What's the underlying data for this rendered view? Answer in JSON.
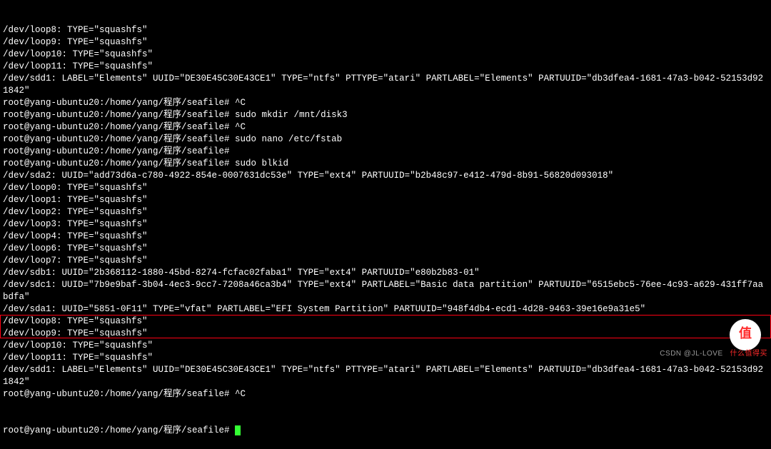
{
  "lines": [
    "/dev/loop8: TYPE=\"squashfs\"",
    "/dev/loop9: TYPE=\"squashfs\"",
    "/dev/loop10: TYPE=\"squashfs\"",
    "/dev/loop11: TYPE=\"squashfs\"",
    "/dev/sdd1: LABEL=\"Elements\" UUID=\"DE30E45C30E43CE1\" TYPE=\"ntfs\" PTTYPE=\"atari\" PARTLABEL=\"Elements\" PARTUUID=\"db3dfea4-1681-47a3-b042-52153d921842\"",
    "root@yang-ubuntu20:/home/yang/程序/seafile# ^C",
    "root@yang-ubuntu20:/home/yang/程序/seafile# sudo mkdir /mnt/disk3",
    "root@yang-ubuntu20:/home/yang/程序/seafile# ^C",
    "root@yang-ubuntu20:/home/yang/程序/seafile# sudo nano /etc/fstab",
    "root@yang-ubuntu20:/home/yang/程序/seafile#",
    "root@yang-ubuntu20:/home/yang/程序/seafile# sudo blkid",
    "/dev/sda2: UUID=\"add73d6a-c780-4922-854e-0007631dc53e\" TYPE=\"ext4\" PARTUUID=\"b2b48c97-e412-479d-8b91-56820d093018\"",
    "/dev/loop0: TYPE=\"squashfs\"",
    "/dev/loop1: TYPE=\"squashfs\"",
    "/dev/loop2: TYPE=\"squashfs\"",
    "/dev/loop3: TYPE=\"squashfs\"",
    "/dev/loop4: TYPE=\"squashfs\"",
    "/dev/loop6: TYPE=\"squashfs\"",
    "/dev/loop7: TYPE=\"squashfs\"",
    "/dev/sdb1: UUID=\"2b368112-1880-45bd-8274-fcfac02faba1\" TYPE=\"ext4\" PARTUUID=\"e80b2b83-01\"",
    "/dev/sdc1: UUID=\"7b9e9baf-3b04-4ec3-9cc7-7208a46ca3b4\" TYPE=\"ext4\" PARTLABEL=\"Basic data partition\" PARTUUID=\"6515ebc5-76ee-4c93-a629-431ff7aabdfa\"",
    "/dev/sda1: UUID=\"5851-0F11\" TYPE=\"vfat\" PARTLABEL=\"EFI System Partition\" PARTUUID=\"948f4db4-ecd1-4d28-9463-39e16e9a31e5\"",
    "/dev/loop8: TYPE=\"squashfs\"",
    "/dev/loop9: TYPE=\"squashfs\"",
    "/dev/loop10: TYPE=\"squashfs\"",
    "/dev/loop11: TYPE=\"squashfs\"",
    "/dev/sdd1: LABEL=\"Elements\" UUID=\"DE30E45C30E43CE1\" TYPE=\"ntfs\" PTTYPE=\"atari\" PARTLABEL=\"Elements\" PARTUUID=\"db3dfea4-1681-47a3-b042-52153d921842\"",
    "root@yang-ubuntu20:/home/yang/程序/seafile# ^C"
  ],
  "prompt_last": "root@yang-ubuntu20:/home/yang/程序/seafile# ",
  "watermark": {
    "main": "值",
    "sub_left": "CSDN",
    "sub_right": "@JL-LOVE",
    "right_text": "什么值得买"
  }
}
